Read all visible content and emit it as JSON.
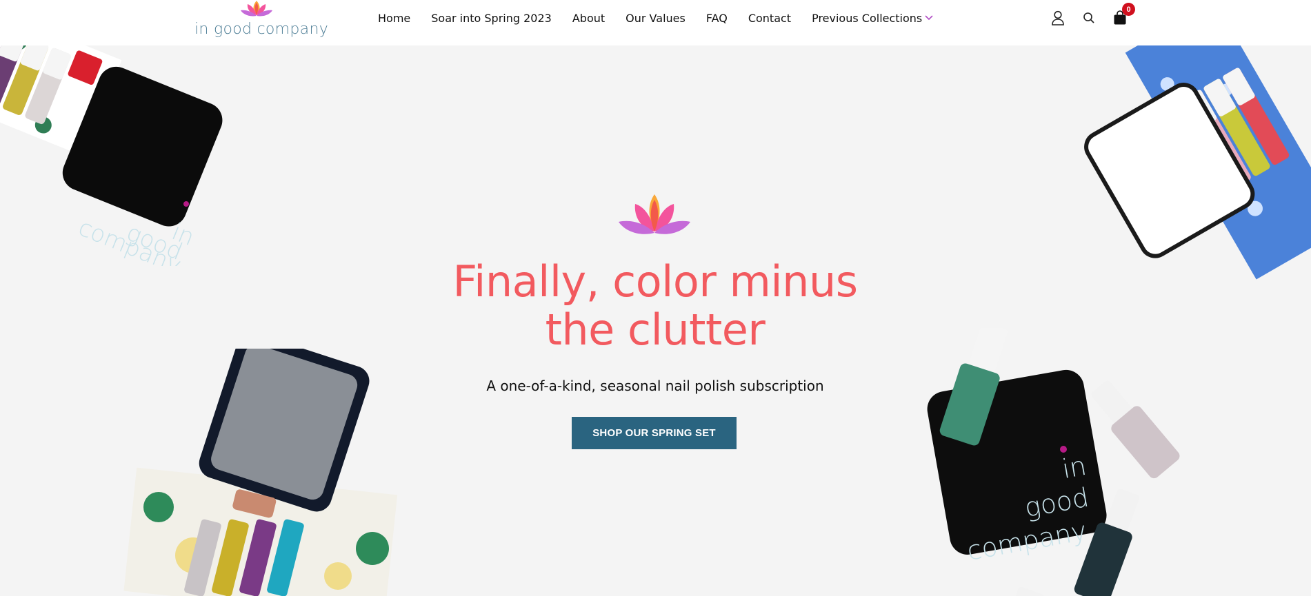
{
  "brand": {
    "name": "in good company"
  },
  "nav": {
    "items": [
      {
        "label": "Home"
      },
      {
        "label": "Soar into Spring 2023"
      },
      {
        "label": "About"
      },
      {
        "label": "Our Values"
      },
      {
        "label": "FAQ"
      },
      {
        "label": "Contact"
      },
      {
        "label": "Previous Collections",
        "has_dropdown": true
      }
    ]
  },
  "header_icons": {
    "account": "user-icon",
    "search": "search-icon",
    "cart": "shopping-bag-icon",
    "cart_count": "0"
  },
  "hero": {
    "title_line1": "Finally, color minus",
    "title_line2": "the clutter",
    "subtitle": "A one-of-a-kind, seasonal nail polish subscription",
    "cta_label": "SHOP OUR SPRING SET"
  },
  "product_tin_text": {
    "line1": "in",
    "line2": "good",
    "line3": "company"
  },
  "colors": {
    "accent_coral": "#f25a5f",
    "button_blue": "#2a6480",
    "logo_teal": "#4f7f97",
    "badge_red": "#d0101e",
    "background": "#f4f4f4"
  }
}
